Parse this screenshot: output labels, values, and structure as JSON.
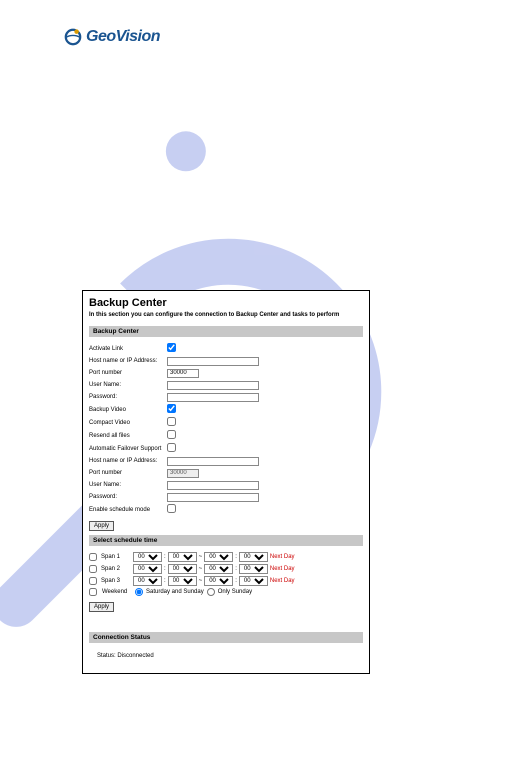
{
  "brand": "GeoVision",
  "panel": {
    "title": "Backup Center",
    "desc": "In this section you can configure the connection to Backup Center and tasks to perform",
    "section_backup": "Backup Center",
    "section_schedule": "Select schedule time",
    "section_status": "Connection Status",
    "status_text": "Status: Disconnected",
    "apply_label": "Apply"
  },
  "fields": {
    "activate_link": "Activate Link",
    "host_ip": "Host name or IP Address:",
    "port_number": "Port number",
    "port_value": "30000",
    "port_value2": "30000",
    "user_name": "User Name:",
    "password": "Password:",
    "backup_video": "Backup Video",
    "compact_video": "Compact Video",
    "resend_all": "Resend all files",
    "auto_failover": "Automatic Failover Support",
    "host_ip2": "Host name or IP Address:",
    "port_number2": "Port number",
    "user_name2": "User Name:",
    "password2": "Password:",
    "enable_schedule": "Enable schedule mode"
  },
  "schedule": {
    "span1": "Span 1",
    "span2": "Span 2",
    "span3": "Span 3",
    "weekend": "Weekend",
    "sat_sun": "Saturday and Sunday",
    "only_sun": "Only Sunday",
    "next_day": "Next Day",
    "hh": "00",
    "mm": "00"
  }
}
